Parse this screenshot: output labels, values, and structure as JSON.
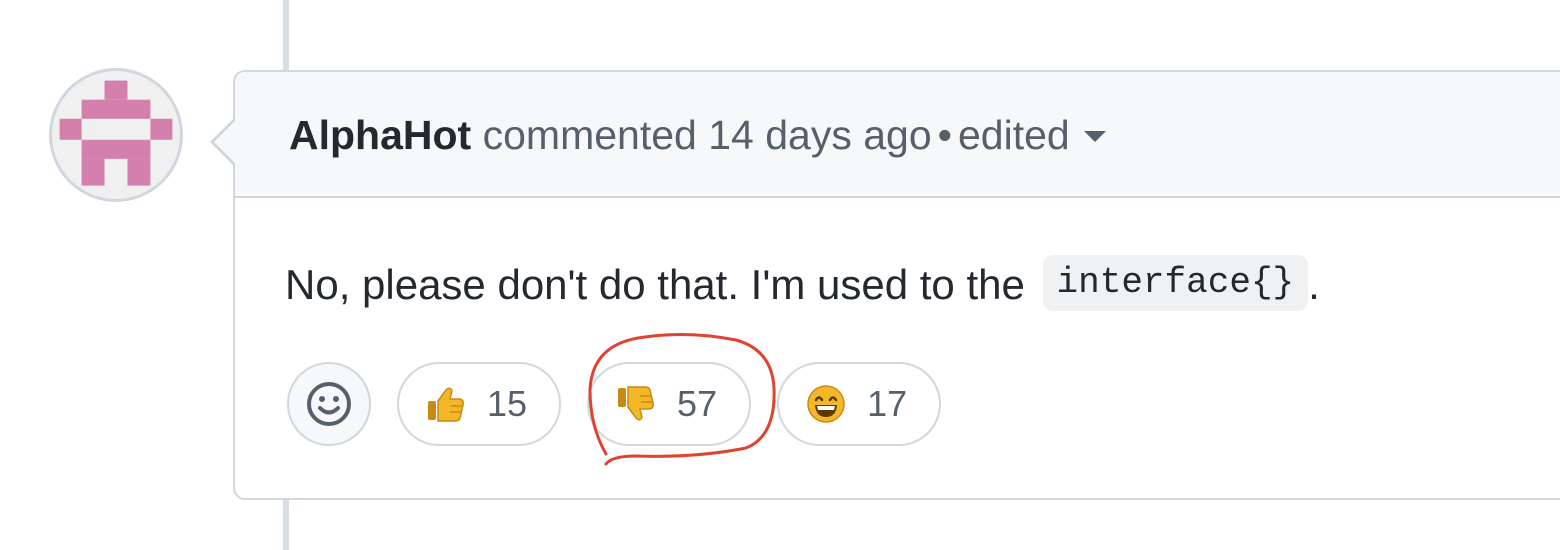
{
  "comment": {
    "author": "AlphaHot",
    "action": "commented",
    "timestamp": "14 days ago",
    "separator": "•",
    "edited_label": "edited",
    "body_text": "No, please don't do that. I'm used to the",
    "body_code": "interface{}",
    "body_suffix": "."
  },
  "reactions": {
    "add_icon": "smiley-icon",
    "items": [
      {
        "icon": "thumbs-up-icon",
        "count": "15"
      },
      {
        "icon": "thumbs-down-icon",
        "count": "57"
      },
      {
        "icon": "grinning-face-icon",
        "count": "17"
      }
    ]
  },
  "colors": {
    "avatar_accent": "#d480ad",
    "annotation": "#e0432f",
    "emoji_yellow": "#f5b72a",
    "border": "#d0d7de",
    "header_bg": "#f6f8fa"
  }
}
